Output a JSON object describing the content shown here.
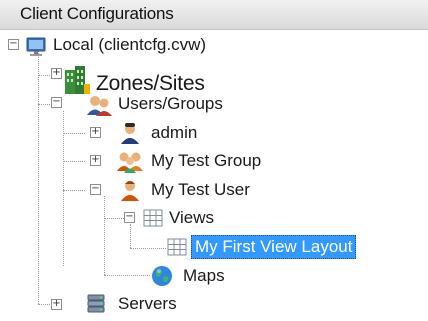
{
  "panel": {
    "title": "Client Configurations"
  },
  "tree": {
    "root": {
      "label": "Local (clientcfg.cvw)",
      "icon": "computer-icon"
    },
    "zones": {
      "label": "Zones/Sites",
      "icon": "building-icon"
    },
    "users_groups": {
      "label": "Users/Groups",
      "icon": "users-icon"
    },
    "admin": {
      "label": "admin",
      "icon": "admin-user-icon"
    },
    "test_group": {
      "label": "My Test Group",
      "icon": "group-icon"
    },
    "test_user": {
      "label": "My Test User",
      "icon": "user-icon"
    },
    "views": {
      "label": "Views",
      "icon": "grid-icon"
    },
    "view_layout": {
      "label": "My First View Layout",
      "icon": "grid-icon",
      "selected": true
    },
    "maps": {
      "label": "Maps",
      "icon": "globe-icon"
    },
    "servers": {
      "label": "Servers",
      "icon": "database-icon"
    }
  },
  "expanders": {
    "expanded": "−",
    "collapsed": "+"
  },
  "colors": {
    "selection": "#3399ff",
    "header": "#e2e2e2"
  }
}
